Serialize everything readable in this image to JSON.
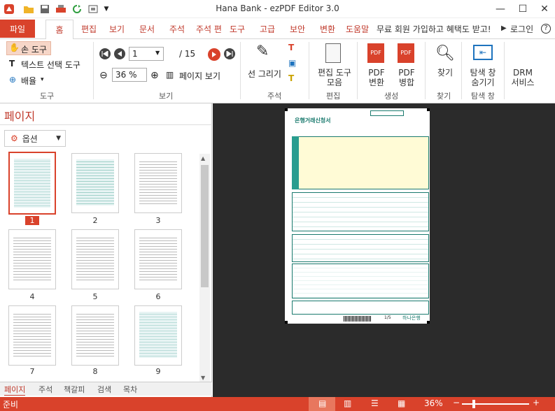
{
  "window": {
    "title": "Hana Bank  -  ezPDF Editor 3.0",
    "minimize": "—",
    "maximize": "☐",
    "close": "✕"
  },
  "menu": {
    "file": "파일",
    "tabs": [
      "홈",
      "편집",
      "보기",
      "문서",
      "주석",
      "주석 편",
      "도구",
      "고급",
      "보안",
      "변환",
      "도움말"
    ],
    "promo": "무료 회원 가입하고 혜택도 받고!",
    "promo_arrow": "▶",
    "login": "로그인",
    "help": "?"
  },
  "ribbon": {
    "tools": {
      "hand": "손 도구",
      "text_select": "텍스트 선택 도구",
      "zoom": "배율",
      "zoom_arrow": "▾",
      "group": "도구"
    },
    "view": {
      "page_value": "1",
      "page_total": "/ 15",
      "zoom_value": "36 %",
      "page_view": "페이지 보기",
      "group": "보기"
    },
    "annot": {
      "pen": "선 그리기",
      "group": "주석"
    },
    "edit": {
      "tools": "편집 도구\n모음",
      "group": "편집"
    },
    "create": {
      "pdf_convert": "PDF\n변환",
      "pdf_merge": "PDF\n병합",
      "group": "생성"
    },
    "find": {
      "find": "찾기",
      "group": "찾기"
    },
    "tabwin": {
      "dock": "탐색 창\n숨기기",
      "group": "탐색 창"
    },
    "drm": {
      "drm": "DRM\n서비스"
    }
  },
  "panel": {
    "title": "페이지",
    "options": "옵션",
    "thumbnails": [
      "1",
      "2",
      "3",
      "4",
      "5",
      "6",
      "7",
      "8",
      "9"
    ],
    "tabs": [
      "페이지",
      "주석",
      "책갈피",
      "검색",
      "목차"
    ]
  },
  "document": {
    "form_title": "은행거래신청서",
    "page_label": "1/5",
    "bank_logo": "하나은행"
  },
  "status": {
    "ready": "준비",
    "zoom": "36%",
    "minus": "−",
    "plus": "+"
  }
}
